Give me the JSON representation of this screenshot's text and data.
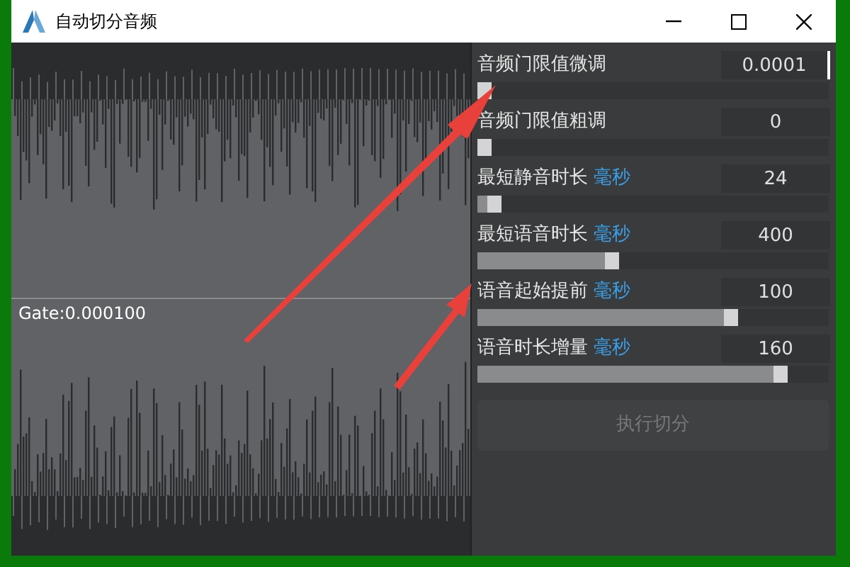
{
  "window": {
    "title": "自动切分音频"
  },
  "waveform": {
    "gate_label": "Gate:0.000100"
  },
  "settings": [
    {
      "label": "音频门限值微调",
      "value": "0.0001",
      "focused": true,
      "level": 0
    },
    {
      "label": "音频门限值粗调",
      "value": "0",
      "focused": false,
      "level": 0
    },
    {
      "label": "最短静音时长",
      "unit": "毫秒",
      "value": "24",
      "focused": false,
      "level": 0.03
    },
    {
      "label": "最短语音时长",
      "unit": "毫秒",
      "value": "400",
      "focused": false,
      "level": 0.38
    },
    {
      "label": "语音起始提前",
      "unit": "毫秒",
      "value": "100",
      "focused": false,
      "level": 0.73
    },
    {
      "label": "语音时长增量",
      "unit": "毫秒",
      "value": "160",
      "focused": false,
      "level": 0.88
    }
  ],
  "run_button": {
    "label": "执行切分",
    "disabled": true
  }
}
